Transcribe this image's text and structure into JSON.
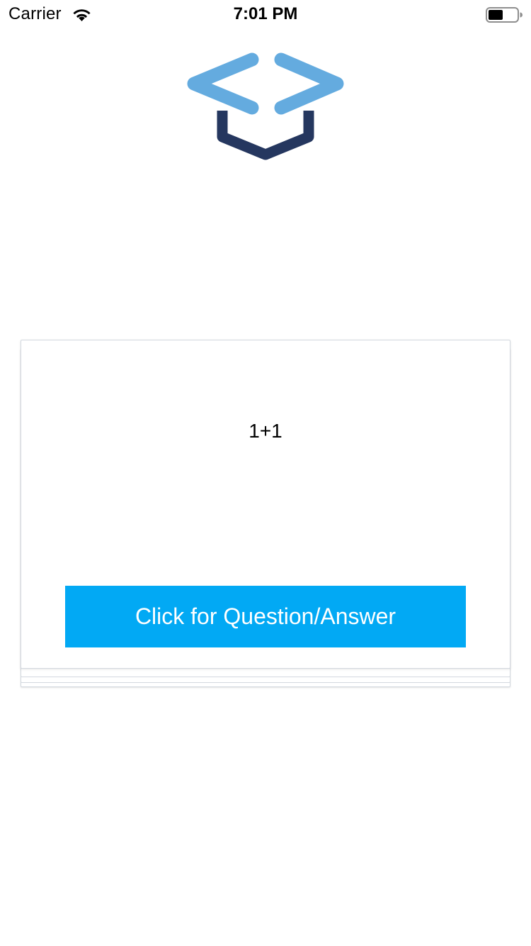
{
  "status_bar": {
    "carrier": "Carrier",
    "time": "7:01 PM",
    "wifi_icon": "wifi-icon",
    "battery_icon": "battery-icon",
    "battery_level": 0.5
  },
  "logo": {
    "icon": "graduation-cap-code-brackets-icon",
    "colors": {
      "brackets": "#64abdf",
      "base": "#25375f"
    }
  },
  "card": {
    "text": "1+1",
    "button_label": "Click for Question/Answer",
    "button_color": "#02a9f4"
  }
}
